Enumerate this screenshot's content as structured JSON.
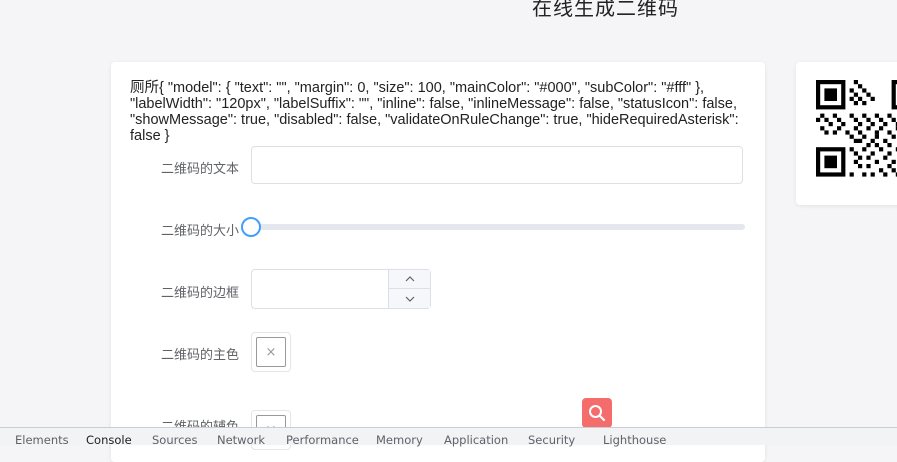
{
  "page": {
    "title": "在线生成二维码"
  },
  "form": {
    "debug_text": "厕所{ \"model\": { \"text\": \"\", \"margin\": 0, \"size\": 100, \"mainColor\": \"#000\", \"subColor\": \"#fff\" }, \"labelWidth\": \"120px\", \"labelSuffix\": \"\", \"inline\": false, \"inlineMessage\": false, \"statusIcon\": false, \"showMessage\": true, \"disabled\": false, \"validateOnRuleChange\": true, \"hideRequiredAsterisk\": false }",
    "text_label": "二维码的文本",
    "text_value": "",
    "size_label": "二维码的大小",
    "size_value": 0,
    "margin_label": "二维码的边框",
    "margin_value": "",
    "main_color_label": "二维码的主色",
    "main_color_empty_symbol": "×",
    "sub_color_label": "二维码的辅色",
    "sub_color_empty_symbol": "×"
  },
  "stepper": {
    "up_symbol": "⌃",
    "down_symbol": "⌄"
  },
  "icons": {
    "search": "search-icon",
    "qr": "qr-code-image",
    "slider": "slider-handle"
  },
  "colors": {
    "accent": "#409eff",
    "fab": "#f56c6c",
    "qr": "#000000"
  },
  "devtools": {
    "tabs": [
      "Elements",
      "Console",
      "Sources",
      "Network",
      "Performance",
      "Memory",
      "Application",
      "Security",
      "Lighthouse"
    ],
    "active_tab": "Console"
  }
}
